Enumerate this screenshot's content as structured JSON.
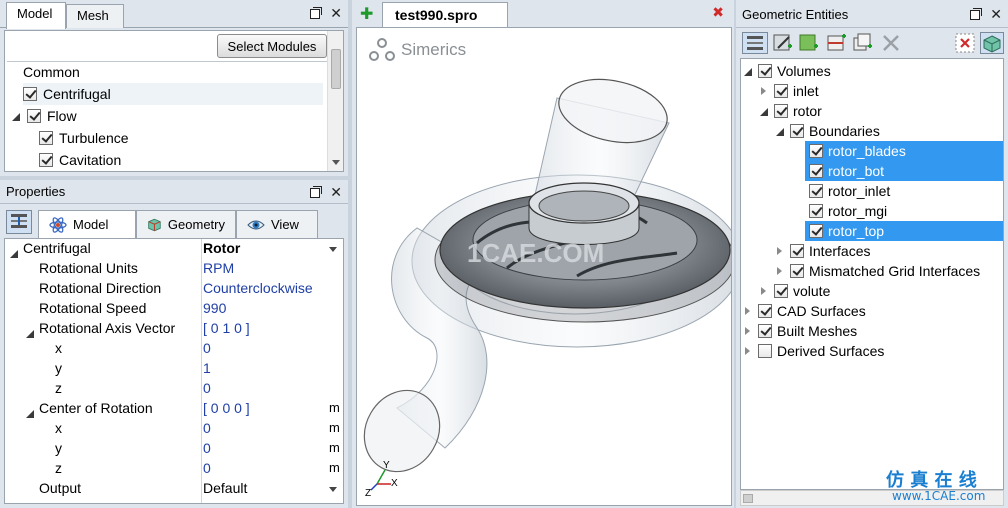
{
  "left_panel": {
    "tabs": [
      {
        "label": "Model"
      },
      {
        "label": "Mesh"
      }
    ],
    "select_modules_label": "Select Modules",
    "modules": [
      {
        "label": "Common",
        "checkbox": false
      },
      {
        "label": "Centrifugal",
        "checked": true
      },
      {
        "label": "Flow",
        "checked": true,
        "expanded": true
      },
      {
        "label": "Turbulence",
        "checked": true
      },
      {
        "label": "Cavitation",
        "checked": true
      }
    ]
  },
  "properties": {
    "title": "Properties",
    "tabs": [
      {
        "label": "Model",
        "icon": "atom-icon"
      },
      {
        "label": "Geometry",
        "icon": "cube-icon"
      },
      {
        "label": "View",
        "icon": "eye-icon"
      }
    ],
    "rows": [
      {
        "name": "Centrifugal",
        "value": "Rotor",
        "unit": ""
      },
      {
        "name": "Rotational Units",
        "value": "RPM",
        "unit": ""
      },
      {
        "name": "Rotational Direction",
        "value": "Counterclockwise",
        "unit": ""
      },
      {
        "name": "Rotational Speed",
        "value": "990",
        "unit": ""
      },
      {
        "name": "Rotational Axis Vector",
        "value": "[ 0 1 0 ]",
        "unit": ""
      },
      {
        "name": "x",
        "value": "0",
        "unit": ""
      },
      {
        "name": "y",
        "value": "1",
        "unit": ""
      },
      {
        "name": "z",
        "value": "0",
        "unit": ""
      },
      {
        "name": "Center of Rotation",
        "value": "[ 0 0 0 ]",
        "unit": "m"
      },
      {
        "name": "x",
        "value": "0",
        "unit": "m"
      },
      {
        "name": "y",
        "value": "0",
        "unit": "m"
      },
      {
        "name": "z",
        "value": "0",
        "unit": "m"
      },
      {
        "name": "Output",
        "value": "Default",
        "unit": ""
      }
    ]
  },
  "viewport": {
    "doc_tab": "test990.spro",
    "logo_text": "Simerics",
    "watermark": "1CAE.COM",
    "axis_x": "X",
    "axis_y": "Y",
    "axis_z": "Z"
  },
  "geometric_entities": {
    "title": "Geometric Entities",
    "tree": [
      {
        "label": "Volumes",
        "level": 0,
        "expander": "open",
        "checked": true
      },
      {
        "label": "inlet",
        "level": 1,
        "expander": "closed",
        "checked": true
      },
      {
        "label": "rotor",
        "level": 1,
        "expander": "open",
        "checked": true
      },
      {
        "label": "Boundaries",
        "level": 2,
        "expander": "open",
        "checked": true
      },
      {
        "label": "rotor_blades",
        "level": 3,
        "expander": "none",
        "checked": true,
        "selected": true
      },
      {
        "label": "rotor_bot",
        "level": 3,
        "expander": "none",
        "checked": true,
        "selected": true
      },
      {
        "label": "rotor_inlet",
        "level": 3,
        "expander": "none",
        "checked": true
      },
      {
        "label": "rotor_mgi",
        "level": 3,
        "expander": "none",
        "checked": true
      },
      {
        "label": "rotor_top",
        "level": 3,
        "expander": "none",
        "checked": true,
        "selected": true
      },
      {
        "label": "Interfaces",
        "level": 2,
        "expander": "closed",
        "checked": true
      },
      {
        "label": "Mismatched Grid Interfaces",
        "level": 2,
        "expander": "closed",
        "checked": true
      },
      {
        "label": "volute",
        "level": 1,
        "expander": "closed",
        "checked": true
      },
      {
        "label": "CAD Surfaces",
        "level": 0,
        "expander": "closed",
        "checked": true
      },
      {
        "label": "Built Meshes",
        "level": 0,
        "expander": "closed",
        "checked": true
      },
      {
        "label": "Derived Surfaces",
        "level": 0,
        "expander": "closed",
        "checked": false
      }
    ],
    "watermark_cn": "仿 真 在 线",
    "watermark_url": "www.1CAE.com"
  },
  "colors": {
    "selection": "#3399f0",
    "value_blue": "#1f3fa6"
  }
}
